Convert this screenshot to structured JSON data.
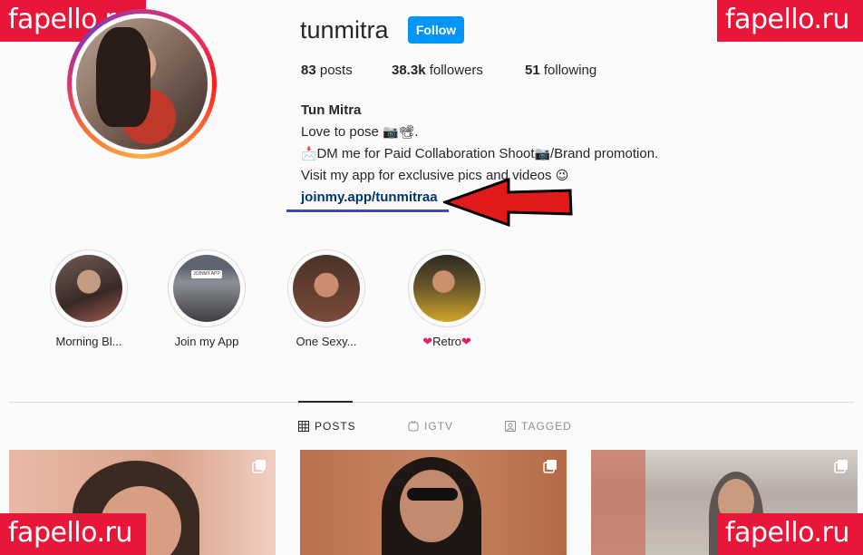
{
  "watermark": "fapello.ru",
  "profile": {
    "username": "tunmitra",
    "follow_label": "Follow",
    "stats": {
      "posts_count": "83",
      "posts_label": " posts",
      "followers_count": "38.3k",
      "followers_label": " followers",
      "following_count": "51",
      "following_label": " following"
    },
    "bio": {
      "name": "Tun Mitra",
      "line1": "Love to pose ",
      "line1_emoji": "📷📽",
      "line1_end": ".",
      "line2_emoji_start": "📩",
      "line2": "DM me for Paid Collaboration Shoot",
      "line2_emoji_mid": "📷",
      "line2_end": "/Brand promotion.",
      "line3": "Visit my app for exclusive pics and videos ",
      "line3_emoji": "😉",
      "link": "joinmy.app/tunmitraa"
    }
  },
  "highlights": [
    {
      "label": "Morning Bl...",
      "badge": ""
    },
    {
      "label": "Join my App",
      "badge": "JOINMY.APP"
    },
    {
      "label": "One Sexy...",
      "badge": ""
    },
    {
      "label_prefix": "❤",
      "label": "Retro",
      "label_suffix": "❤",
      "badge": ""
    }
  ],
  "tabs": {
    "posts": "POSTS",
    "igtv": "IGTV",
    "tagged": "TAGGED"
  },
  "colors": {
    "accent": "#0095f6",
    "watermark_bg": "#e8173a",
    "arrow": "#e11b1b",
    "underline": "#3e4bb5",
    "link": "#00376b"
  },
  "icons": [
    "grid-icon",
    "igtv-icon",
    "tagged-icon",
    "multiple-posts-icon"
  ]
}
